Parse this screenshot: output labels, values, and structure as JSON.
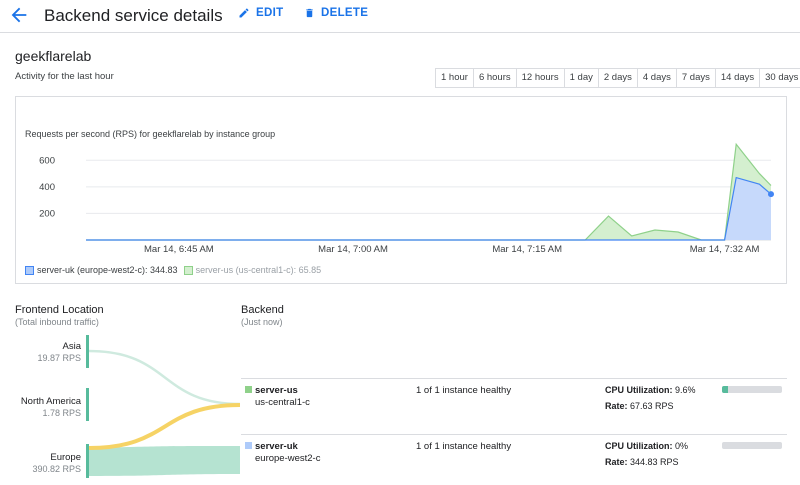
{
  "header": {
    "title": "Backend service details",
    "edit_label": "EDIT",
    "delete_label": "DELETE"
  },
  "service": {
    "name": "geekflarelab",
    "activity_label": "Activity for the last hour"
  },
  "time_ranges": [
    "1 hour",
    "6 hours",
    "12 hours",
    "1 day",
    "2 days",
    "4 days",
    "7 days",
    "14 days",
    "30 days"
  ],
  "chart_data": {
    "type": "area",
    "title": "Requests per second (RPS) for geekflarelab by instance group",
    "x": [
      "6:37",
      "6:40",
      "6:45",
      "6:50",
      "6:55",
      "7:00",
      "7:05",
      "7:10",
      "7:15",
      "7:20",
      "7:22",
      "7:24",
      "7:26",
      "7:28",
      "7:30",
      "7:32",
      "7:33",
      "7:35",
      "7:36"
    ],
    "x_ticks": [
      "Mar 14, 6:45 AM",
      "Mar 14, 7:00 AM",
      "Mar 14, 7:15 AM",
      "Mar 14, 7:32 AM"
    ],
    "y_ticks": [
      "600",
      "400",
      "200"
    ],
    "ylim": [
      0,
      700
    ],
    "grid": true,
    "legend_position": "bottom-left",
    "series": [
      {
        "name": "server-uk (europe-west2-c)",
        "legend_label": "server-uk (europe-west2-c): 344.83",
        "color": "#4285f4",
        "fill": "#c6d9fb",
        "values": [
          0,
          0,
          0,
          0,
          0,
          0,
          0,
          0,
          0,
          0,
          0,
          0,
          0,
          0,
          0,
          0,
          470,
          420,
          345
        ]
      },
      {
        "name": "server-us (us-central1-c)",
        "legend_label": "server-us (us-central1-c): 65.85",
        "color": "#8fd18a",
        "fill": "#d4efcf",
        "values": [
          0,
          0,
          0,
          0,
          0,
          0,
          0,
          0,
          0,
          0,
          180,
          30,
          75,
          60,
          0,
          0,
          720,
          500,
          410
        ]
      }
    ]
  },
  "frontend": {
    "heading": "Frontend Location",
    "subheading": "(Total inbound traffic)",
    "locations": [
      {
        "name": "Asia",
        "rps": "19.87 RPS"
      },
      {
        "name": "North America",
        "rps": "1.78 RPS"
      },
      {
        "name": "Europe",
        "rps": "390.82 RPS"
      }
    ]
  },
  "backend": {
    "heading": "Backend",
    "subheading": "(Just now)",
    "rows": [
      {
        "name": "server-us",
        "zone": "us-central1-c",
        "health": "1 of 1 instance healthy",
        "cpu_label": "CPU Utilization:",
        "cpu_value": "9.6%",
        "cpu_fraction": 0.096,
        "rate_label": "Rate:",
        "rate_value": "67.63 RPS",
        "color": "#8fd18a"
      },
      {
        "name": "server-uk",
        "zone": "europe-west2-c",
        "health": "1 of 1 instance healthy",
        "cpu_label": "CPU Utilization:",
        "cpu_value": "0%",
        "cpu_fraction": 0,
        "rate_label": "Rate:",
        "rate_value": "344.83 RPS",
        "color": "#aecbfa"
      }
    ]
  },
  "colors": {
    "accent": "#1a73e8",
    "frontend_bar": "#57bb9c",
    "flow_asia": "#cfeadf",
    "flow_north_america": "#f6d365",
    "flow_europe": "#a8dec9"
  }
}
